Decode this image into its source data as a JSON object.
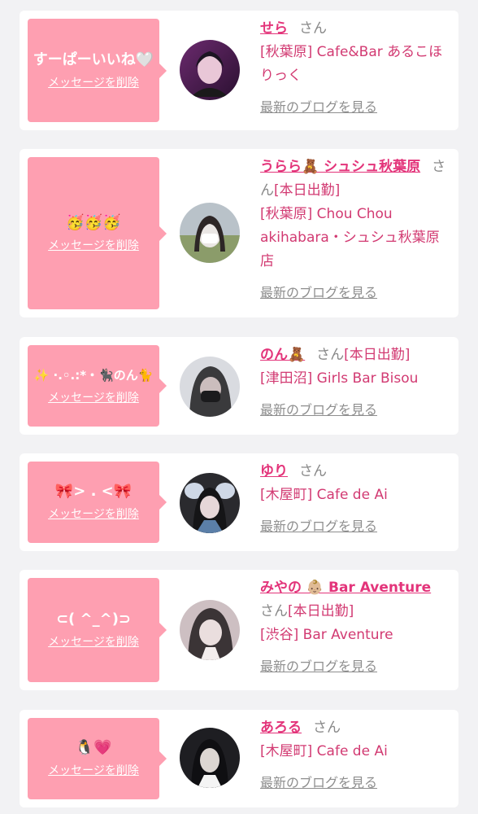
{
  "items": [
    {
      "message": "すーぱーいいね🤍",
      "delete_label": "メッセージを削除",
      "name": "せら",
      "honorific": "さん",
      "tag": "",
      "shop": "[秋葉原] Cafe&Bar あるこほりっく",
      "blog_link": "最新のブログを見る",
      "avatar_colors": [
        "#6b2a6e",
        "#e9c7d7"
      ]
    },
    {
      "message": "🥳🥳🥳",
      "delete_label": "メッセージを削除",
      "name": "うらら🧸 シュシュ秋葉原",
      "honorific": "さん",
      "tag": "[本日出勤]",
      "shop": "[秋葉原] Chou Chou akihabara・シュシュ秋葉原店",
      "blog_link": "最新のブログを見る",
      "avatar_colors": [
        "#b9c2c9",
        "#eae6e4"
      ]
    },
    {
      "message": "✨ ·.◦.:*・🐈‍⬛のん🐈",
      "delete_label": "メッセージを削除",
      "name": "のん🧸",
      "honorific": "さん",
      "tag": "[本日出勤]",
      "shop": "[津田沼] Girls Bar Bisou",
      "blog_link": "最新のブログを見る",
      "avatar_colors": [
        "#3a3a3c",
        "#d9dbe0"
      ]
    },
    {
      "message": "🎀> . <🎀",
      "delete_label": "メッセージを削除",
      "name": "ゆり",
      "honorific": "さん",
      "tag": "",
      "shop": "[木屋町] Cafe de Ai",
      "blog_link": "最新のブログを見る",
      "avatar_colors": [
        "#2a2a2e",
        "#cfd8e6"
      ]
    },
    {
      "message": "⊂( ^_^)⊃",
      "delete_label": "メッセージを削除",
      "name": "みやの 👶🏼 Bar Aventure",
      "honorific": "さん",
      "tag": "[本日出勤]",
      "shop": "[渋谷] Bar Aventure",
      "blog_link": "最新のブログを見る",
      "avatar_colors": [
        "#3b3436",
        "#cdbfc2"
      ]
    },
    {
      "message": "🐧💗",
      "delete_label": "メッセージを削除",
      "name": "あろる",
      "honorific": "さん",
      "tag": "",
      "shop": "[木屋町] Cafe de Ai",
      "blog_link": "最新のブログを見る",
      "avatar_colors": [
        "#1e1e22",
        "#dcd6d2"
      ]
    }
  ]
}
